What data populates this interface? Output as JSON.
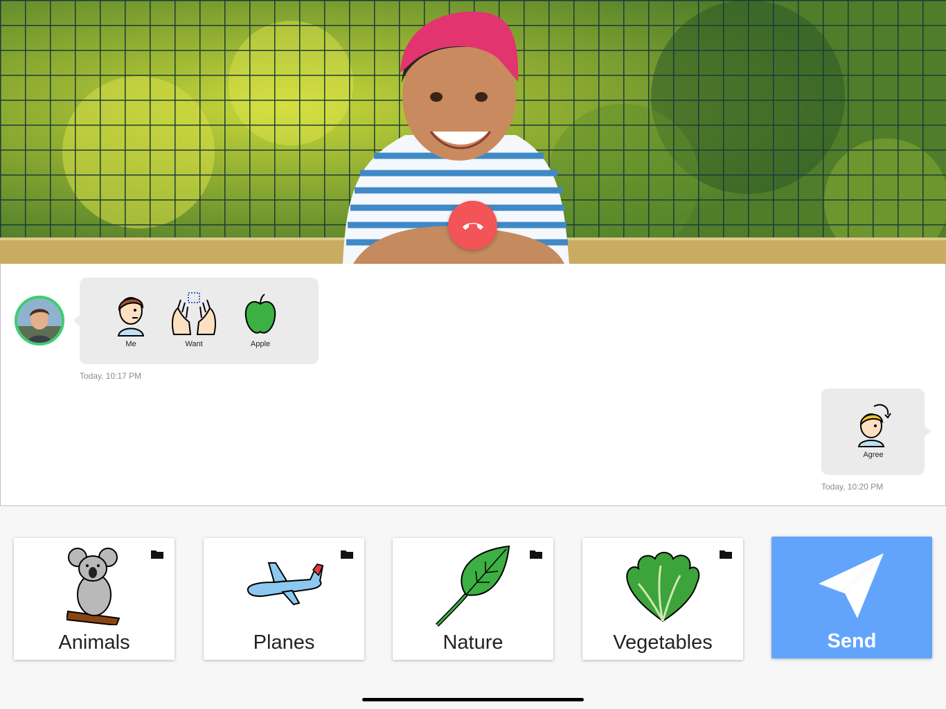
{
  "call": {
    "hangup_icon": "phone-hangup-icon",
    "accent_color": "#f25457"
  },
  "conversation": {
    "incoming": {
      "avatar_ring_color": "#3ccf6f",
      "symbols": [
        {
          "label": "Me",
          "icon": "person-me-icon"
        },
        {
          "label": "Want",
          "icon": "hands-want-icon"
        },
        {
          "label": "Apple",
          "icon": "apple-icon"
        }
      ],
      "timestamp": "Today, 10:17 PM"
    },
    "outgoing": {
      "symbols": [
        {
          "label": "Agree",
          "icon": "person-agree-icon"
        }
      ],
      "timestamp": "Today, 10:20 PM"
    }
  },
  "board": {
    "tiles": [
      {
        "label": "Animals",
        "icon": "koala-icon",
        "folder": true
      },
      {
        "label": "Planes",
        "icon": "airplane-icon",
        "folder": true
      },
      {
        "label": "Nature",
        "icon": "leaf-icon",
        "folder": true
      },
      {
        "label": "Vegetables",
        "icon": "lettuce-icon",
        "folder": true
      }
    ],
    "send": {
      "label": "Send",
      "icon": "paper-plane-icon",
      "color": "#62a4fb"
    }
  }
}
